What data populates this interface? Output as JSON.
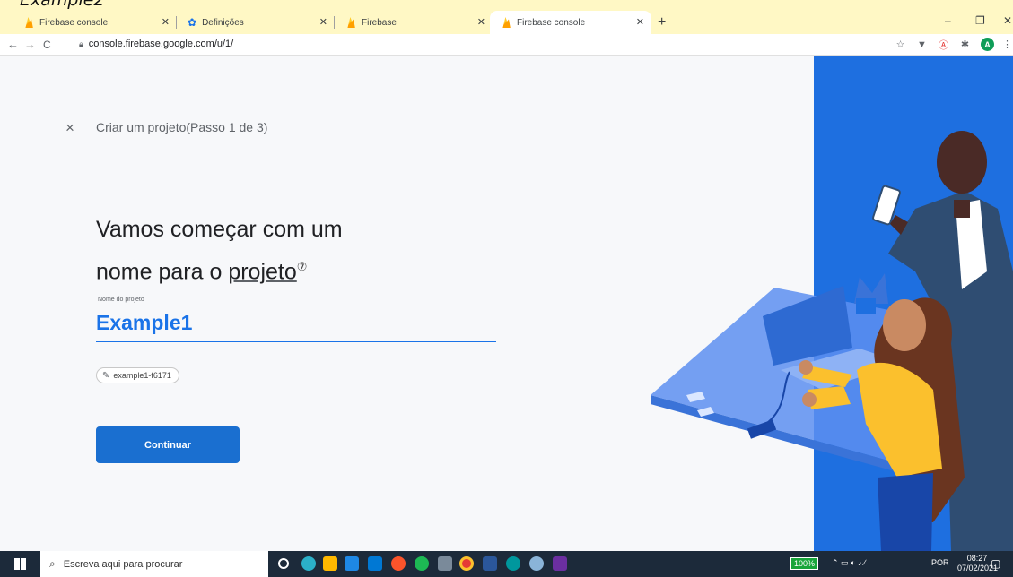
{
  "cropped_title": "Example2",
  "browser": {
    "tabs": [
      {
        "label": "Firebase console",
        "icon": "firebase-icon"
      },
      {
        "label": "Definições",
        "icon": "gear-icon"
      },
      {
        "label": "Firebase",
        "icon": "firebase-icon"
      },
      {
        "label": "Firebase console",
        "icon": "firebase-icon",
        "active": true
      }
    ],
    "new_tab": "+",
    "window_controls": {
      "minimize": "–",
      "maximize": "❐",
      "close": "✕"
    },
    "nav": {
      "back": "←",
      "forward": "→",
      "reload": "C"
    },
    "url": "console.firebase.google.com/u/1/",
    "profile_initial": "A"
  },
  "wizard": {
    "close": "×",
    "step": "Criar um projeto(Passo 1 de 3)",
    "heading_line1": "Vamos começar com um",
    "heading_line2_prefix": "nome para o ",
    "heading_line2_link": "projeto",
    "help_icon": "⑦",
    "field_label": "Nome do projeto",
    "project_name": "Example1",
    "project_id": "example1-f6171",
    "continue_label": "Continuar"
  },
  "taskbar": {
    "search_placeholder": "Escreva aqui para procurar",
    "battery": "100%",
    "lang": "POR",
    "time": "08:27",
    "date": "07/02/2021"
  },
  "colors": {
    "accent": "#1a73e8",
    "button": "#1a6fd0",
    "illustration_blue": "#1e6fe0",
    "browser_chrome": "#fff8c5"
  }
}
